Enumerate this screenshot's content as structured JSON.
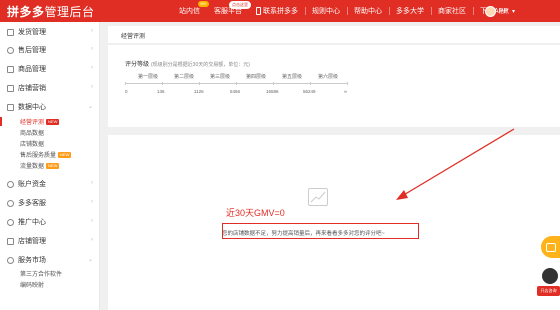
{
  "brand": {
    "logo": "拼多多",
    "title": "管理后台"
  },
  "topnav": {
    "items": [
      {
        "label": "站内信",
        "badge": "99+"
      },
      {
        "label": "客服平台",
        "badge": "点击这里"
      },
      {
        "label": "联系拼多多"
      },
      {
        "label": "规则中心"
      },
      {
        "label": "帮助中心"
      },
      {
        "label": "多多大学"
      },
      {
        "label": "商家社区"
      },
      {
        "label": "下载APP"
      }
    ],
    "user_name": "拾贰",
    "user_caret": "▾"
  },
  "sidebar": {
    "groups": [
      {
        "label": "发货管理"
      },
      {
        "label": "售后管理"
      },
      {
        "label": "商品管理"
      },
      {
        "label": "店铺营销"
      },
      {
        "label": "数据中心"
      },
      {
        "label": "账户资金"
      },
      {
        "label": "多多客服"
      },
      {
        "label": "推广中心"
      },
      {
        "label": "店铺管理"
      },
      {
        "label": "服务市场"
      }
    ],
    "data_center_subs": [
      {
        "label": "经营评测",
        "tag": "NEW"
      },
      {
        "label": "商品数据"
      },
      {
        "label": "店铺数据"
      },
      {
        "label": "售后服务质量",
        "tag": "NEW"
      },
      {
        "label": "流量数据",
        "tag": "NEW"
      }
    ],
    "service_subs": [
      {
        "label": "第三方合作软件"
      },
      {
        "label": "编码映射"
      }
    ]
  },
  "main": {
    "panel_title": "经营评测",
    "level": {
      "title": "评分等级",
      "note": "(现级别分是根据近30天的交易额，单位：元)",
      "labels": [
        "第一层级",
        "第二层级",
        "第三层级",
        "第四层级",
        "第五层级",
        "第六层级"
      ],
      "values": [
        "0",
        "136",
        "1126",
        "5456",
        "16586",
        "56249",
        "∞"
      ]
    },
    "empty_text": "您的店铺数据不足，努力提高销量后，再来看看多多对您的评分吧~",
    "annotation": "近30天GMV=0"
  },
  "float": {
    "cs_label": "开店咨询"
  },
  "colors": {
    "brand_red": "#e02e24",
    "orange": "#ffb31a"
  }
}
